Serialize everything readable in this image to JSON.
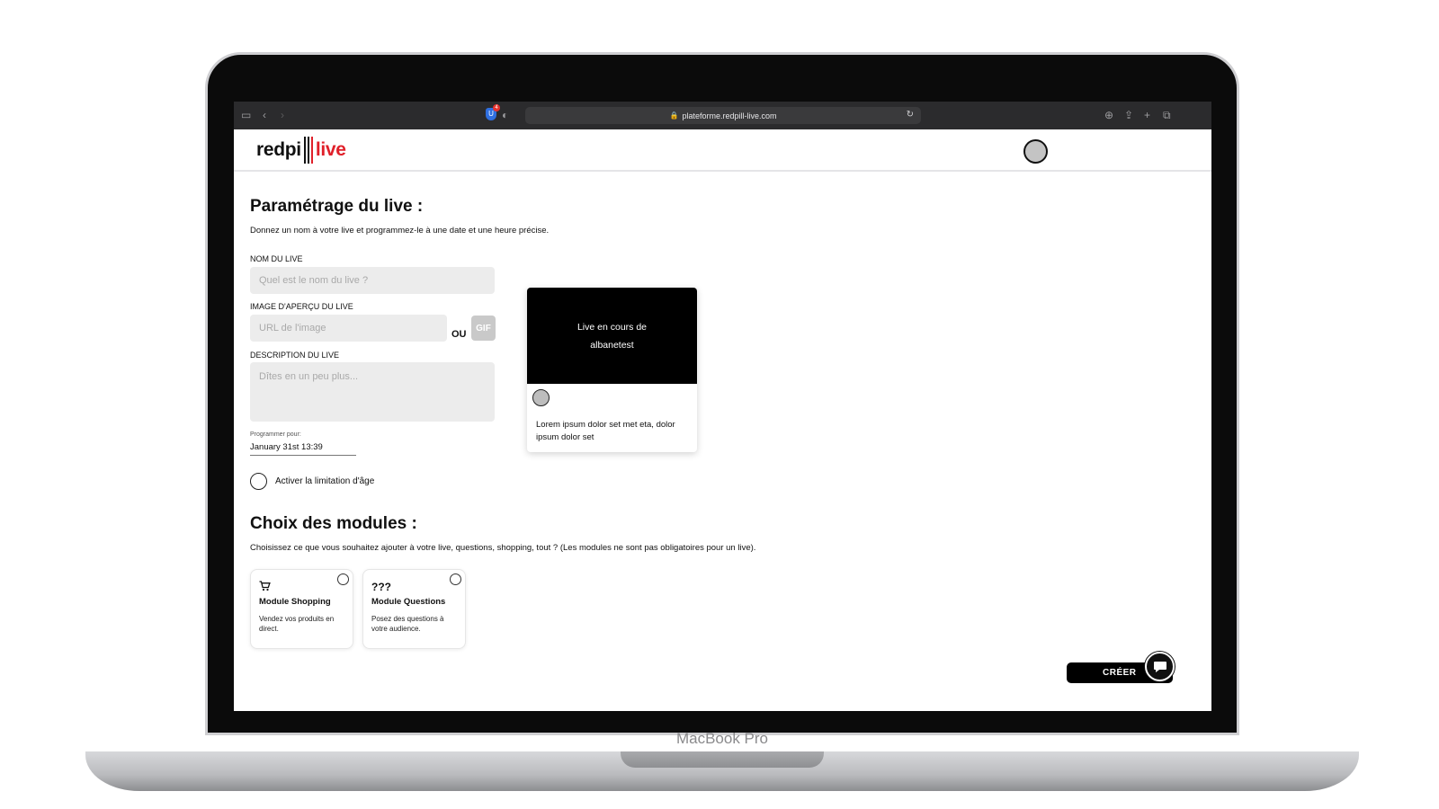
{
  "device": {
    "brand_label": "MacBook Pro"
  },
  "browser": {
    "url": "plateforme.redpill-live.com",
    "extension_badge": "4"
  },
  "header": {
    "logo_primary": "redpi",
    "logo_secondary": "live",
    "logo_bar_colors": [
      "#111111",
      "#111111",
      "#e0202a"
    ]
  },
  "settings": {
    "title": "Paramétrage du live :",
    "subtitle": "Donnez un nom à votre live et programmez-le à une date et une heure précise.",
    "name_label": "NOM DU LIVE",
    "name_placeholder": "Quel est le nom du live ?",
    "image_label": "IMAGE D'APERÇU DU LIVE",
    "image_placeholder": "URL de l'image",
    "or_label": "OU",
    "gif_label": "GIF",
    "description_label": "DESCRIPTION DU LIVE",
    "description_placeholder": "Dîtes en un peu plus...",
    "schedule_label": "Programmer pour:",
    "schedule_value": "January 31st 13:39",
    "age_limit_label": "Activer la limitation d'âge"
  },
  "preview": {
    "title_line1": "Live en cours de",
    "title_line2": "albanetest",
    "description": "Lorem ipsum dolor set met eta, dolor ipsum dolor set"
  },
  "modules": {
    "title": "Choix des modules :",
    "subtitle": "Choisissez ce que vous souhaitez ajouter à votre live, questions, shopping, tout ? (Les modules ne sont pas obligatoires pour un live).",
    "items": [
      {
        "icon": "shopping-cart-icon",
        "icon_text": "",
        "title": "Module Shopping",
        "description": "Vendez vos produits en direct."
      },
      {
        "icon": "question-marks-icon",
        "icon_text": "???",
        "title": "Module Questions",
        "description": "Posez des questions à votre audience."
      }
    ]
  },
  "actions": {
    "create_label": "CRÉER"
  },
  "colors": {
    "accent": "#e0202a",
    "primary": "#000000",
    "input_bg": "#ececec"
  }
}
